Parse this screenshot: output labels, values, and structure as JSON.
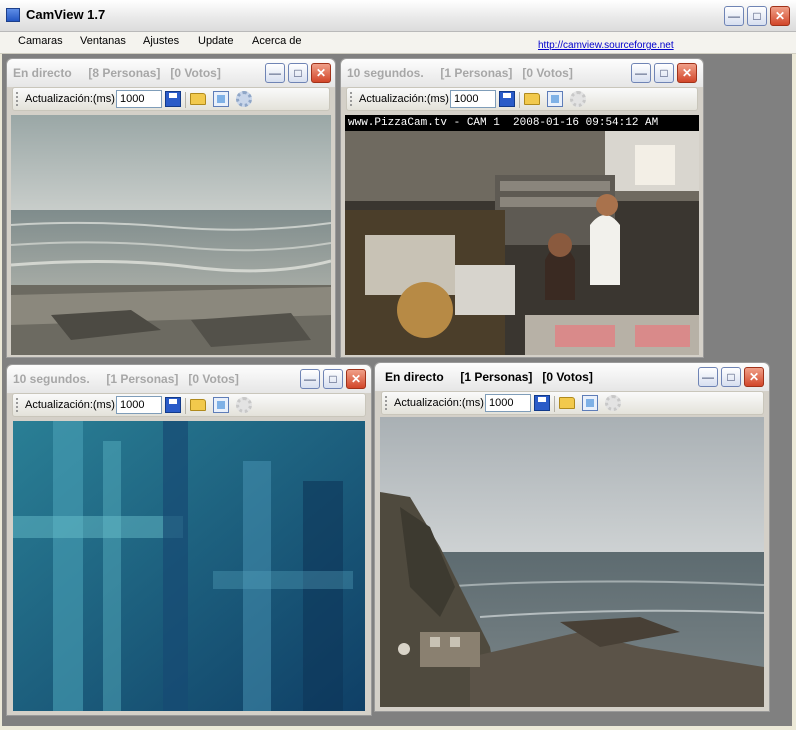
{
  "app": {
    "title": "CamView 1.7",
    "icon": "camera-app-icon"
  },
  "menu": {
    "items": [
      "Camaras",
      "Ventanas",
      "Ajustes",
      "Update",
      "Acerca de"
    ],
    "link": "http://camview.sourceforge.net"
  },
  "windows": [
    {
      "title": "En directo     [8 Personas]   [0 Votos]",
      "refresh_label": "Actualización:(ms)",
      "refresh_value": "1000",
      "active": false
    },
    {
      "title": "10 segundos.     [1 Personas]   [0 Votos]",
      "refresh_label": "Actualización:(ms)",
      "refresh_value": "1000",
      "active": false,
      "overlay_text": "www.PizzaCam.tv - CAM 1  2008-01-16 09:54:12 AM"
    },
    {
      "title": "10 segundos.     [1 Personas]   [0 Votos]",
      "refresh_label": "Actualización:(ms)",
      "refresh_value": "1000",
      "active": false
    },
    {
      "title": "En directo     [1 Personas]   [0 Votos]",
      "refresh_label": "Actualización:(ms)",
      "refresh_value": "1000",
      "active": true
    }
  ],
  "colors": {
    "desktop": "#808080",
    "titlebar_close": "#d2472a",
    "accent": "#2a5bc8"
  }
}
